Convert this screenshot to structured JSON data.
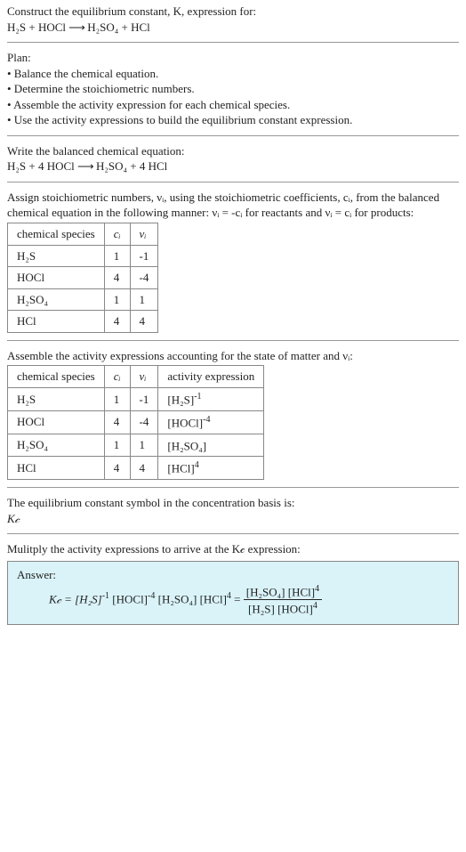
{
  "intro": {
    "line1": "Construct the equilibrium constant, K, expression for:",
    "eq_lhs": "H₂S + HOCl",
    "arrow": "⟶",
    "eq_rhs": "H₂SO₄ + HCl"
  },
  "plan": {
    "title": "Plan:",
    "items": [
      "• Balance the chemical equation.",
      "• Determine the stoichiometric numbers.",
      "• Assemble the activity expression for each chemical species.",
      "• Use the activity expressions to build the equilibrium constant expression."
    ]
  },
  "balanced": {
    "label": "Write the balanced chemical equation:",
    "lhs": "H₂S + 4 HOCl",
    "arrow": "⟶",
    "rhs": "H₂SO₄ + 4 HCl"
  },
  "stoich": {
    "text1": "Assign stoichiometric numbers, νᵢ, using the stoichiometric coefficients, cᵢ, from the balanced chemical equation in the following manner: νᵢ = -cᵢ for reactants and νᵢ = cᵢ for products:",
    "headers": [
      "chemical species",
      "cᵢ",
      "νᵢ"
    ],
    "rows": [
      [
        "H₂S",
        "1",
        "-1"
      ],
      [
        "HOCl",
        "4",
        "-4"
      ],
      [
        "H₂SO₄",
        "1",
        "1"
      ],
      [
        "HCl",
        "4",
        "4"
      ]
    ]
  },
  "activity": {
    "text": "Assemble the activity expressions accounting for the state of matter and νᵢ:",
    "headers": [
      "chemical species",
      "cᵢ",
      "νᵢ",
      "activity expression"
    ],
    "rows": [
      {
        "sp": "H₂S",
        "c": "1",
        "v": "-1",
        "expr_base": "[H₂S]",
        "expr_sup": "-1"
      },
      {
        "sp": "HOCl",
        "c": "4",
        "v": "-4",
        "expr_base": "[HOCl]",
        "expr_sup": "-4"
      },
      {
        "sp": "H₂SO₄",
        "c": "1",
        "v": "1",
        "expr_base": "[H₂SO₄]",
        "expr_sup": ""
      },
      {
        "sp": "HCl",
        "c": "4",
        "v": "4",
        "expr_base": "[HCl]",
        "expr_sup": "4"
      }
    ]
  },
  "basis": {
    "text": "The equilibrium constant symbol in the concentration basis is:",
    "symbol": "K𝒸"
  },
  "multiply": {
    "text": "Mulitply the activity expressions to arrive at the K𝒸 expression:"
  },
  "answer": {
    "label": "Answer:",
    "lhs": "K𝒸 = [H₂S]",
    "sup1": "-1",
    "t2": " [HOCl]",
    "sup2": "-4",
    "t3": " [H₂SO₄] [HCl]",
    "sup3": "4",
    "eq": " = ",
    "num1": "[H₂SO₄] [HCl]",
    "num_sup": "4",
    "den1": "[H₂S] [HOCl]",
    "den_sup": "4"
  }
}
